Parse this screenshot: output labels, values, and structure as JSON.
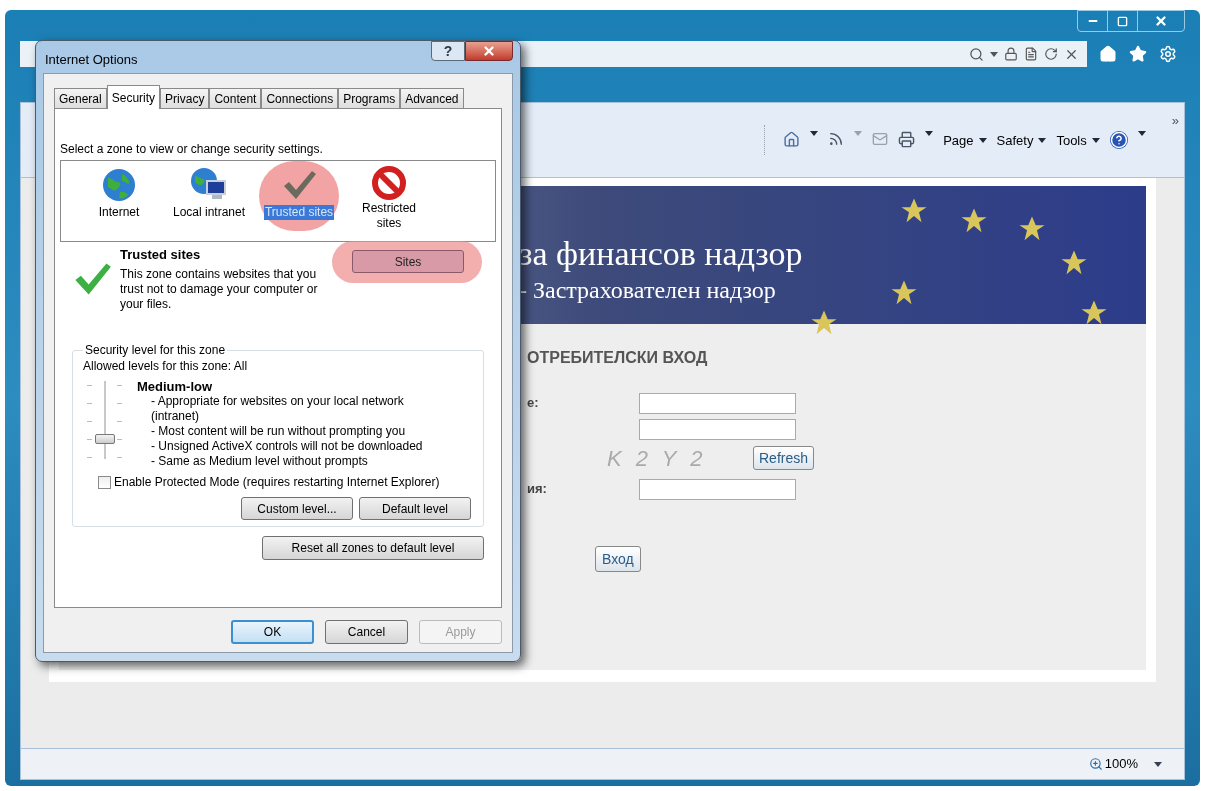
{
  "browser": {
    "command_bar": {
      "menus": [
        {
          "label": "Page"
        },
        {
          "label": "Safety"
        },
        {
          "label": "Tools"
        }
      ],
      "overflow": "»"
    },
    "page": {
      "banner": {
        "title": "за финансов надзор",
        "subtitle": "- Застрахователен надзор"
      },
      "login": {
        "heading": "ОТРЕБИТЕЛСКИ ВХОД",
        "field_1_label": "е:",
        "captcha": "K 2 Y 2",
        "refresh_button": "Refresh",
        "field_3_label": "ия:",
        "submit_button": "Вход"
      }
    },
    "status_bar": {
      "zoom": "100%"
    }
  },
  "dialog": {
    "title": "Internet Options",
    "help_button": "?",
    "tabs": [
      {
        "label": "General",
        "selected": false
      },
      {
        "label": "Security",
        "selected": true
      },
      {
        "label": "Privacy",
        "selected": false
      },
      {
        "label": "Content",
        "selected": false
      },
      {
        "label": "Connections",
        "selected": false
      },
      {
        "label": "Programs",
        "selected": false
      },
      {
        "label": "Advanced",
        "selected": false
      }
    ],
    "zone_prompt": "Select a zone to view or change security settings.",
    "zones": [
      {
        "label": "Internet",
        "kind": "globe",
        "selected": false,
        "highlighted": false
      },
      {
        "label": "Local intranet",
        "kind": "intranet",
        "selected": false,
        "highlighted": false
      },
      {
        "label": "Trusted sites",
        "kind": "check",
        "selected": true,
        "highlighted": true
      },
      {
        "label": "Restricted sites",
        "kind": "blocked",
        "selected": false,
        "highlighted": false
      }
    ],
    "zone_info": {
      "title": "Trusted sites",
      "description": "This zone contains websites that you trust not to damage your computer or your files.",
      "sites_button": "Sites",
      "sites_highlighted": true
    },
    "security_level": {
      "legend": "Security level for this zone",
      "allowed": "Allowed levels for this zone: All",
      "level": 0.25,
      "level_name": "Medium-low",
      "bullets": [
        "- Appropriate for websites on your local network (intranet)",
        "- Most content will be run without prompting you",
        "- Unsigned ActiveX controls will not be downloaded",
        "- Same as Medium level without prompts"
      ],
      "protected_mode": {
        "label": "Enable Protected Mode (requires restarting Internet Explorer)",
        "checked": false
      },
      "buttons": [
        {
          "label": "Custom level..."
        },
        {
          "label": "Default level"
        }
      ]
    },
    "reset_button": "Reset all zones to default level",
    "footer_buttons": [
      {
        "label": "OK",
        "default": true,
        "disabled": false
      },
      {
        "label": "Cancel",
        "default": false,
        "disabled": false
      },
      {
        "label": "Apply",
        "default": false,
        "disabled": true
      }
    ]
  }
}
